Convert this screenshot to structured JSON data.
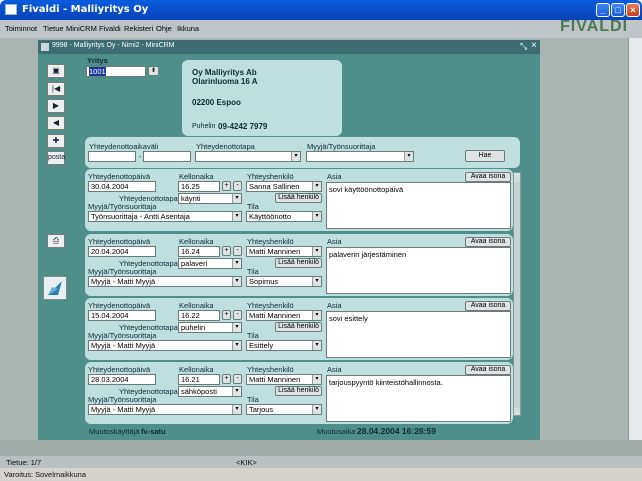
{
  "window": {
    "title": "Fivaldi - Malliyritys Oy"
  },
  "menu": [
    "Toiminnot",
    "Tietue",
    "MiniCRM",
    "Fivaldi",
    "Rekisteri",
    "Ohje",
    "Ikkuna"
  ],
  "brand": "FIVALDI",
  "inner": {
    "title": "9998 - Malliyritys Oy - Nimi2 - MiniCRM"
  },
  "toolbar": {
    "posta_label": "posta"
  },
  "company": {
    "yritys_label": "Yritys",
    "yritys_value": "1001",
    "name": "Oy Malliyritys Ab",
    "street": "Olarinluoma 16 A",
    "postal": "02200 Espoo",
    "phone_label": "Puhelin",
    "phone": "09-4242 7979"
  },
  "search": {
    "period_label": "Yhteydenottoaikaväli",
    "dash": "-",
    "method_label": "Yhteydenottotapa",
    "seller_label": "Myyjä/Työnsuorittaja",
    "hae": "Hae"
  },
  "labels": {
    "date": "Yhteydenottopäivä",
    "time": "Kellonaika",
    "contact": "Yhteyshenkilö",
    "subject": "Asia",
    "open": "Avaa isona",
    "method": "Yhteydenottotapa",
    "seller": "Myyjä/Työnsuorittaja",
    "add_person": "Lisää henkilö",
    "state": "Tila",
    "plus": "+",
    "minus": "-"
  },
  "rows": [
    {
      "date": "30.04.2004",
      "time": "16.25",
      "method": "käynti",
      "contact": "Sanna Sallinen",
      "seller": "Työnsuorittaja - Antti Asentaja",
      "state": "Käyttöönotto",
      "subject": "sovi käyttöönottopäivä"
    },
    {
      "date": "20.04.2004",
      "time": "16.24",
      "method": "palaveri",
      "contact": "Matti Manninen",
      "seller": "Myyjä - Matti Myyjä",
      "state": "Sopimus",
      "subject": "palaverin järjestäminen"
    },
    {
      "date": "15.04.2004",
      "time": "16.22",
      "method": "puhelin",
      "contact": "Matti Manninen",
      "seller": "Myyjä - Matti Myyjä",
      "state": "Esittely",
      "subject": "sovi esittely"
    },
    {
      "date": "28.03.2004",
      "time": "16.21",
      "method": "sähköposti",
      "contact": "Matti Manninen",
      "seller": "Myyjä - Matti Myyjä",
      "state": "Tarjous",
      "subject": "tarjouspyyntö kiinteistöhallinnosta."
    }
  ],
  "footer": {
    "modifier_label": "Muutoskäyttäjä",
    "modifier": "fv-satu",
    "modtime_label": "Muutosaika",
    "modtime": "28.04.2004 16:28:59"
  },
  "status": {
    "record": "Tietue: 1/7",
    "nav": "<KIK>",
    "hint": "Varoitus: Sovelmaikkuna"
  }
}
